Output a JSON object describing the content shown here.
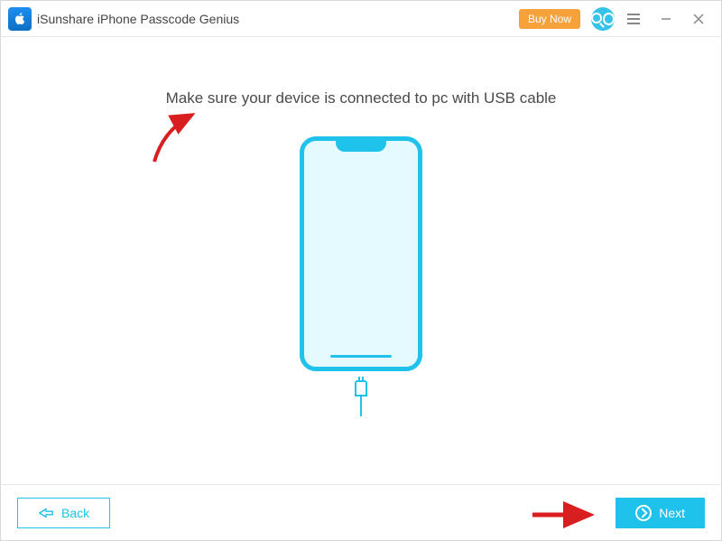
{
  "header": {
    "title": "iSunshare iPhone Passcode Genius",
    "buy_label": "Buy Now"
  },
  "main": {
    "instruction": "Make sure your device is connected to pc with USB cable"
  },
  "footer": {
    "back_label": "Back",
    "next_label": "Next"
  }
}
